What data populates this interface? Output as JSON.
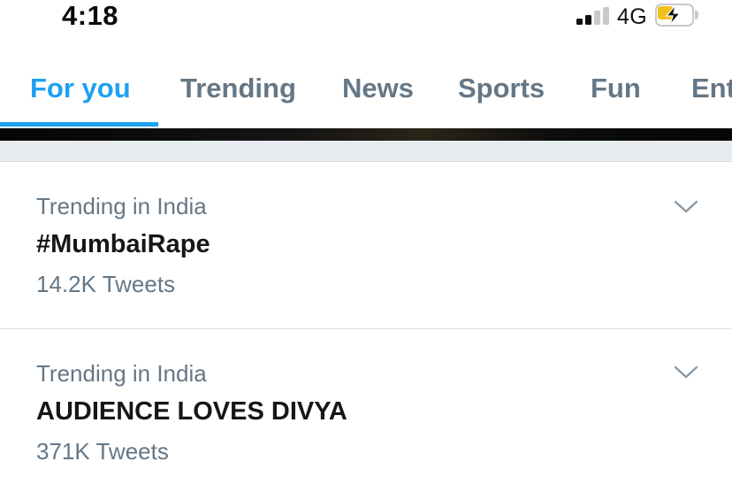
{
  "status_bar": {
    "time": "4:18",
    "network": "4G",
    "battery_level": 0.45,
    "battery_charging": true,
    "signal_bars_active": 2,
    "signal_bars_total": 4
  },
  "tabs": [
    {
      "label": "For you",
      "active": true
    },
    {
      "label": "Trending",
      "active": false
    },
    {
      "label": "News",
      "active": false
    },
    {
      "label": "Sports",
      "active": false
    },
    {
      "label": "Fun",
      "active": false
    },
    {
      "label": "Ent",
      "active": false
    }
  ],
  "trends": [
    {
      "context": "Trending in India",
      "name": "#MumbaiRape",
      "count": "14.2K Tweets"
    },
    {
      "context": "Trending in India",
      "name": "AUDIENCE LOVES DIVYA",
      "count": "371K Tweets"
    }
  ],
  "colors": {
    "accent": "#1da1f2",
    "secondary_text": "#657786",
    "primary_text": "#14171a",
    "battery": "#f2c21a",
    "divider_band": "#e6ecf0"
  },
  "icons": {
    "chevron": "chevron-down-icon",
    "signal": "cellular-signal-icon",
    "battery": "battery-charging-icon"
  }
}
